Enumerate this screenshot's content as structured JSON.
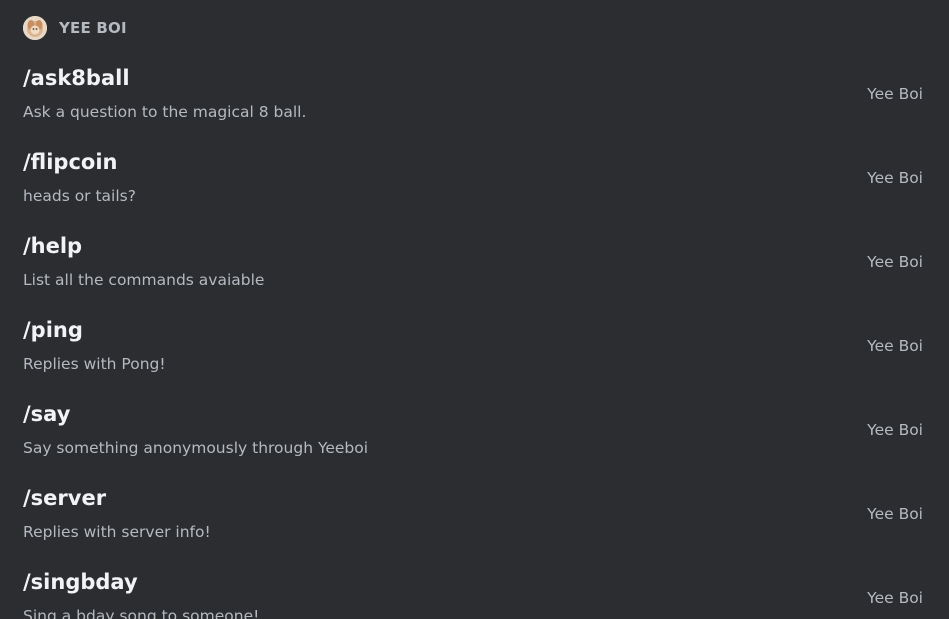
{
  "bot": {
    "name": "YEE BOI",
    "avatar_icon": "bot-avatar-icon"
  },
  "commands": [
    {
      "name": "/ask8ball",
      "description": "Ask a question to the magical 8 ball.",
      "source": "Yee Boi"
    },
    {
      "name": "/flipcoin",
      "description": "heads or tails?",
      "source": "Yee Boi"
    },
    {
      "name": "/help",
      "description": "List all the commands avaiable",
      "source": "Yee Boi"
    },
    {
      "name": "/ping",
      "description": "Replies with Pong!",
      "source": "Yee Boi"
    },
    {
      "name": "/say",
      "description": "Say something anonymously through Yeeboi",
      "source": "Yee Boi"
    },
    {
      "name": "/server",
      "description": "Replies with server info!",
      "source": "Yee Boi"
    },
    {
      "name": "/singbday",
      "description": "Sing a bday song to someone!",
      "source": "Yee Boi"
    }
  ],
  "colors": {
    "background": "#2b2d31",
    "command_name": "#f2f3f5",
    "muted_text": "#b5bac1"
  }
}
